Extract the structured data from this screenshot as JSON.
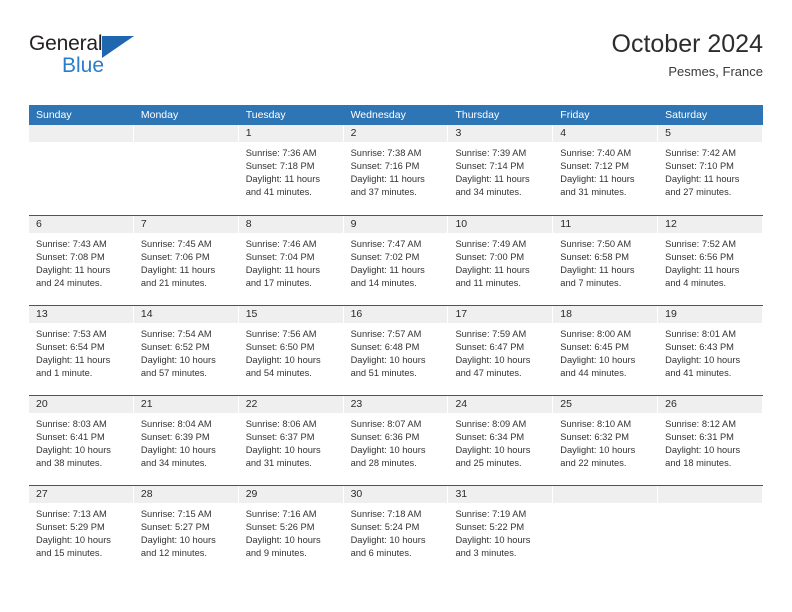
{
  "logo": {
    "word_one": "General",
    "word_two": "Blue",
    "triangle_color": "#1f68b0",
    "blue_color": "#2a7dc9"
  },
  "header": {
    "title": "October 2024",
    "subtitle": "Pesmes, France"
  },
  "theme": {
    "header_band": "#2e75b6",
    "row_divider": "#1f6099",
    "day_band": "#efefef"
  },
  "weekdays": [
    "Sunday",
    "Monday",
    "Tuesday",
    "Wednesday",
    "Thursday",
    "Friday",
    "Saturday"
  ],
  "weeks": [
    [
      {
        "day": "",
        "lines": [],
        "empty": true
      },
      {
        "day": "",
        "lines": [],
        "empty": true
      },
      {
        "day": "1",
        "lines": [
          "Sunrise: 7:36 AM",
          "Sunset: 7:18 PM",
          "Daylight: 11 hours",
          "and 41 minutes."
        ]
      },
      {
        "day": "2",
        "lines": [
          "Sunrise: 7:38 AM",
          "Sunset: 7:16 PM",
          "Daylight: 11 hours",
          "and 37 minutes."
        ]
      },
      {
        "day": "3",
        "lines": [
          "Sunrise: 7:39 AM",
          "Sunset: 7:14 PM",
          "Daylight: 11 hours",
          "and 34 minutes."
        ]
      },
      {
        "day": "4",
        "lines": [
          "Sunrise: 7:40 AM",
          "Sunset: 7:12 PM",
          "Daylight: 11 hours",
          "and 31 minutes."
        ]
      },
      {
        "day": "5",
        "lines": [
          "Sunrise: 7:42 AM",
          "Sunset: 7:10 PM",
          "Daylight: 11 hours",
          "and 27 minutes."
        ]
      }
    ],
    [
      {
        "day": "6",
        "lines": [
          "Sunrise: 7:43 AM",
          "Sunset: 7:08 PM",
          "Daylight: 11 hours",
          "and 24 minutes."
        ]
      },
      {
        "day": "7",
        "lines": [
          "Sunrise: 7:45 AM",
          "Sunset: 7:06 PM",
          "Daylight: 11 hours",
          "and 21 minutes."
        ]
      },
      {
        "day": "8",
        "lines": [
          "Sunrise: 7:46 AM",
          "Sunset: 7:04 PM",
          "Daylight: 11 hours",
          "and 17 minutes."
        ]
      },
      {
        "day": "9",
        "lines": [
          "Sunrise: 7:47 AM",
          "Sunset: 7:02 PM",
          "Daylight: 11 hours",
          "and 14 minutes."
        ]
      },
      {
        "day": "10",
        "lines": [
          "Sunrise: 7:49 AM",
          "Sunset: 7:00 PM",
          "Daylight: 11 hours",
          "and 11 minutes."
        ]
      },
      {
        "day": "11",
        "lines": [
          "Sunrise: 7:50 AM",
          "Sunset: 6:58 PM",
          "Daylight: 11 hours",
          "and 7 minutes."
        ]
      },
      {
        "day": "12",
        "lines": [
          "Sunrise: 7:52 AM",
          "Sunset: 6:56 PM",
          "Daylight: 11 hours",
          "and 4 minutes."
        ]
      }
    ],
    [
      {
        "day": "13",
        "lines": [
          "Sunrise: 7:53 AM",
          "Sunset: 6:54 PM",
          "Daylight: 11 hours",
          "and 1 minute."
        ]
      },
      {
        "day": "14",
        "lines": [
          "Sunrise: 7:54 AM",
          "Sunset: 6:52 PM",
          "Daylight: 10 hours",
          "and 57 minutes."
        ]
      },
      {
        "day": "15",
        "lines": [
          "Sunrise: 7:56 AM",
          "Sunset: 6:50 PM",
          "Daylight: 10 hours",
          "and 54 minutes."
        ]
      },
      {
        "day": "16",
        "lines": [
          "Sunrise: 7:57 AM",
          "Sunset: 6:48 PM",
          "Daylight: 10 hours",
          "and 51 minutes."
        ]
      },
      {
        "day": "17",
        "lines": [
          "Sunrise: 7:59 AM",
          "Sunset: 6:47 PM",
          "Daylight: 10 hours",
          "and 47 minutes."
        ]
      },
      {
        "day": "18",
        "lines": [
          "Sunrise: 8:00 AM",
          "Sunset: 6:45 PM",
          "Daylight: 10 hours",
          "and 44 minutes."
        ]
      },
      {
        "day": "19",
        "lines": [
          "Sunrise: 8:01 AM",
          "Sunset: 6:43 PM",
          "Daylight: 10 hours",
          "and 41 minutes."
        ]
      }
    ],
    [
      {
        "day": "20",
        "lines": [
          "Sunrise: 8:03 AM",
          "Sunset: 6:41 PM",
          "Daylight: 10 hours",
          "and 38 minutes."
        ]
      },
      {
        "day": "21",
        "lines": [
          "Sunrise: 8:04 AM",
          "Sunset: 6:39 PM",
          "Daylight: 10 hours",
          "and 34 minutes."
        ]
      },
      {
        "day": "22",
        "lines": [
          "Sunrise: 8:06 AM",
          "Sunset: 6:37 PM",
          "Daylight: 10 hours",
          "and 31 minutes."
        ]
      },
      {
        "day": "23",
        "lines": [
          "Sunrise: 8:07 AM",
          "Sunset: 6:36 PM",
          "Daylight: 10 hours",
          "and 28 minutes."
        ]
      },
      {
        "day": "24",
        "lines": [
          "Sunrise: 8:09 AM",
          "Sunset: 6:34 PM",
          "Daylight: 10 hours",
          "and 25 minutes."
        ]
      },
      {
        "day": "25",
        "lines": [
          "Sunrise: 8:10 AM",
          "Sunset: 6:32 PM",
          "Daylight: 10 hours",
          "and 22 minutes."
        ]
      },
      {
        "day": "26",
        "lines": [
          "Sunrise: 8:12 AM",
          "Sunset: 6:31 PM",
          "Daylight: 10 hours",
          "and 18 minutes."
        ]
      }
    ],
    [
      {
        "day": "27",
        "lines": [
          "Sunrise: 7:13 AM",
          "Sunset: 5:29 PM",
          "Daylight: 10 hours",
          "and 15 minutes."
        ]
      },
      {
        "day": "28",
        "lines": [
          "Sunrise: 7:15 AM",
          "Sunset: 5:27 PM",
          "Daylight: 10 hours",
          "and 12 minutes."
        ]
      },
      {
        "day": "29",
        "lines": [
          "Sunrise: 7:16 AM",
          "Sunset: 5:26 PM",
          "Daylight: 10 hours",
          "and 9 minutes."
        ]
      },
      {
        "day": "30",
        "lines": [
          "Sunrise: 7:18 AM",
          "Sunset: 5:24 PM",
          "Daylight: 10 hours",
          "and 6 minutes."
        ]
      },
      {
        "day": "31",
        "lines": [
          "Sunrise: 7:19 AM",
          "Sunset: 5:22 PM",
          "Daylight: 10 hours",
          "and 3 minutes."
        ]
      },
      {
        "day": "",
        "lines": [],
        "empty": true
      },
      {
        "day": "",
        "lines": [],
        "empty": true
      }
    ]
  ]
}
